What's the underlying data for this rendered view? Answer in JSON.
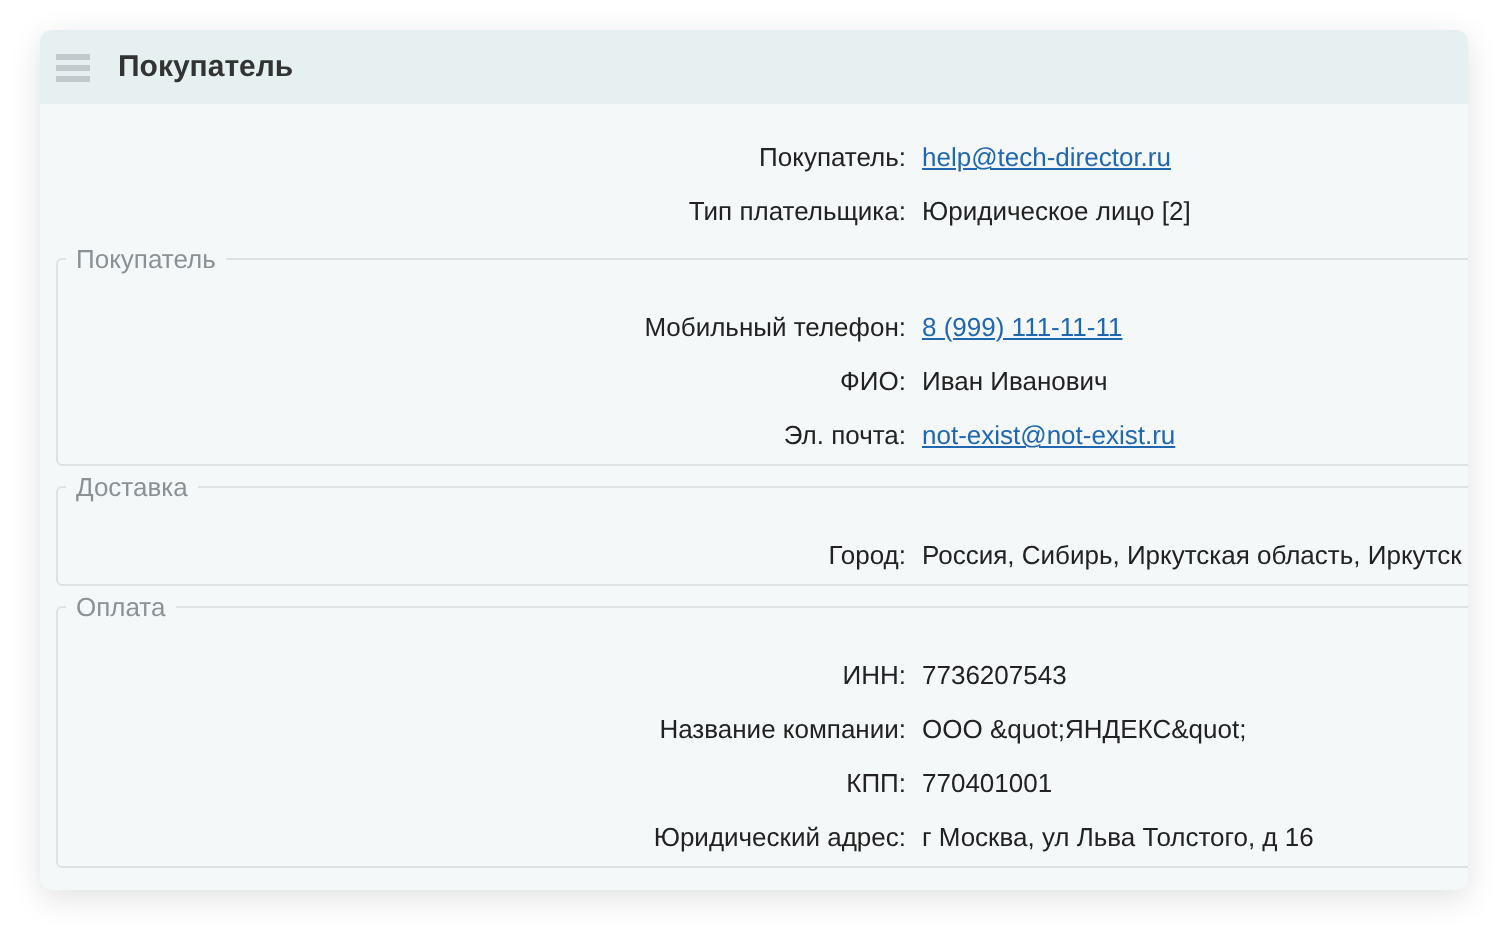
{
  "panel": {
    "title": "Покупатель"
  },
  "fields": [
    {
      "label": "Покупатель:",
      "value": "help@tech-director.ru",
      "kind": "link"
    },
    {
      "label": "Тип плательщика:",
      "value": "Юридическое лицо [2]",
      "kind": "text"
    }
  ],
  "groups": [
    {
      "legend": "Покупатель",
      "fields": [
        {
          "label": "Мобильный телефон:",
          "value": "8 (999) 111-11-11",
          "kind": "link"
        },
        {
          "label": "ФИО:",
          "value": "Иван Иванович",
          "kind": "text"
        },
        {
          "label": "Эл. почта:",
          "value": "not-exist@not-exist.ru",
          "kind": "link"
        }
      ]
    },
    {
      "legend": "Доставка",
      "fields": [
        {
          "label": "Город:",
          "value": "Россия, Сибирь, Иркутская область, Иркутск",
          "kind": "text"
        }
      ]
    },
    {
      "legend": "Оплата",
      "fields": [
        {
          "label": "ИНН:",
          "value": "7736207543",
          "kind": "text"
        },
        {
          "label": "Название компании:",
          "value": "ООО &quot;ЯНДЕКС&quot;",
          "kind": "text"
        },
        {
          "label": "КПП:",
          "value": "770401001",
          "kind": "text"
        },
        {
          "label": "Юридический адрес:",
          "value": "г Москва, ул Льва Толстого, д 16",
          "kind": "text"
        }
      ]
    }
  ]
}
